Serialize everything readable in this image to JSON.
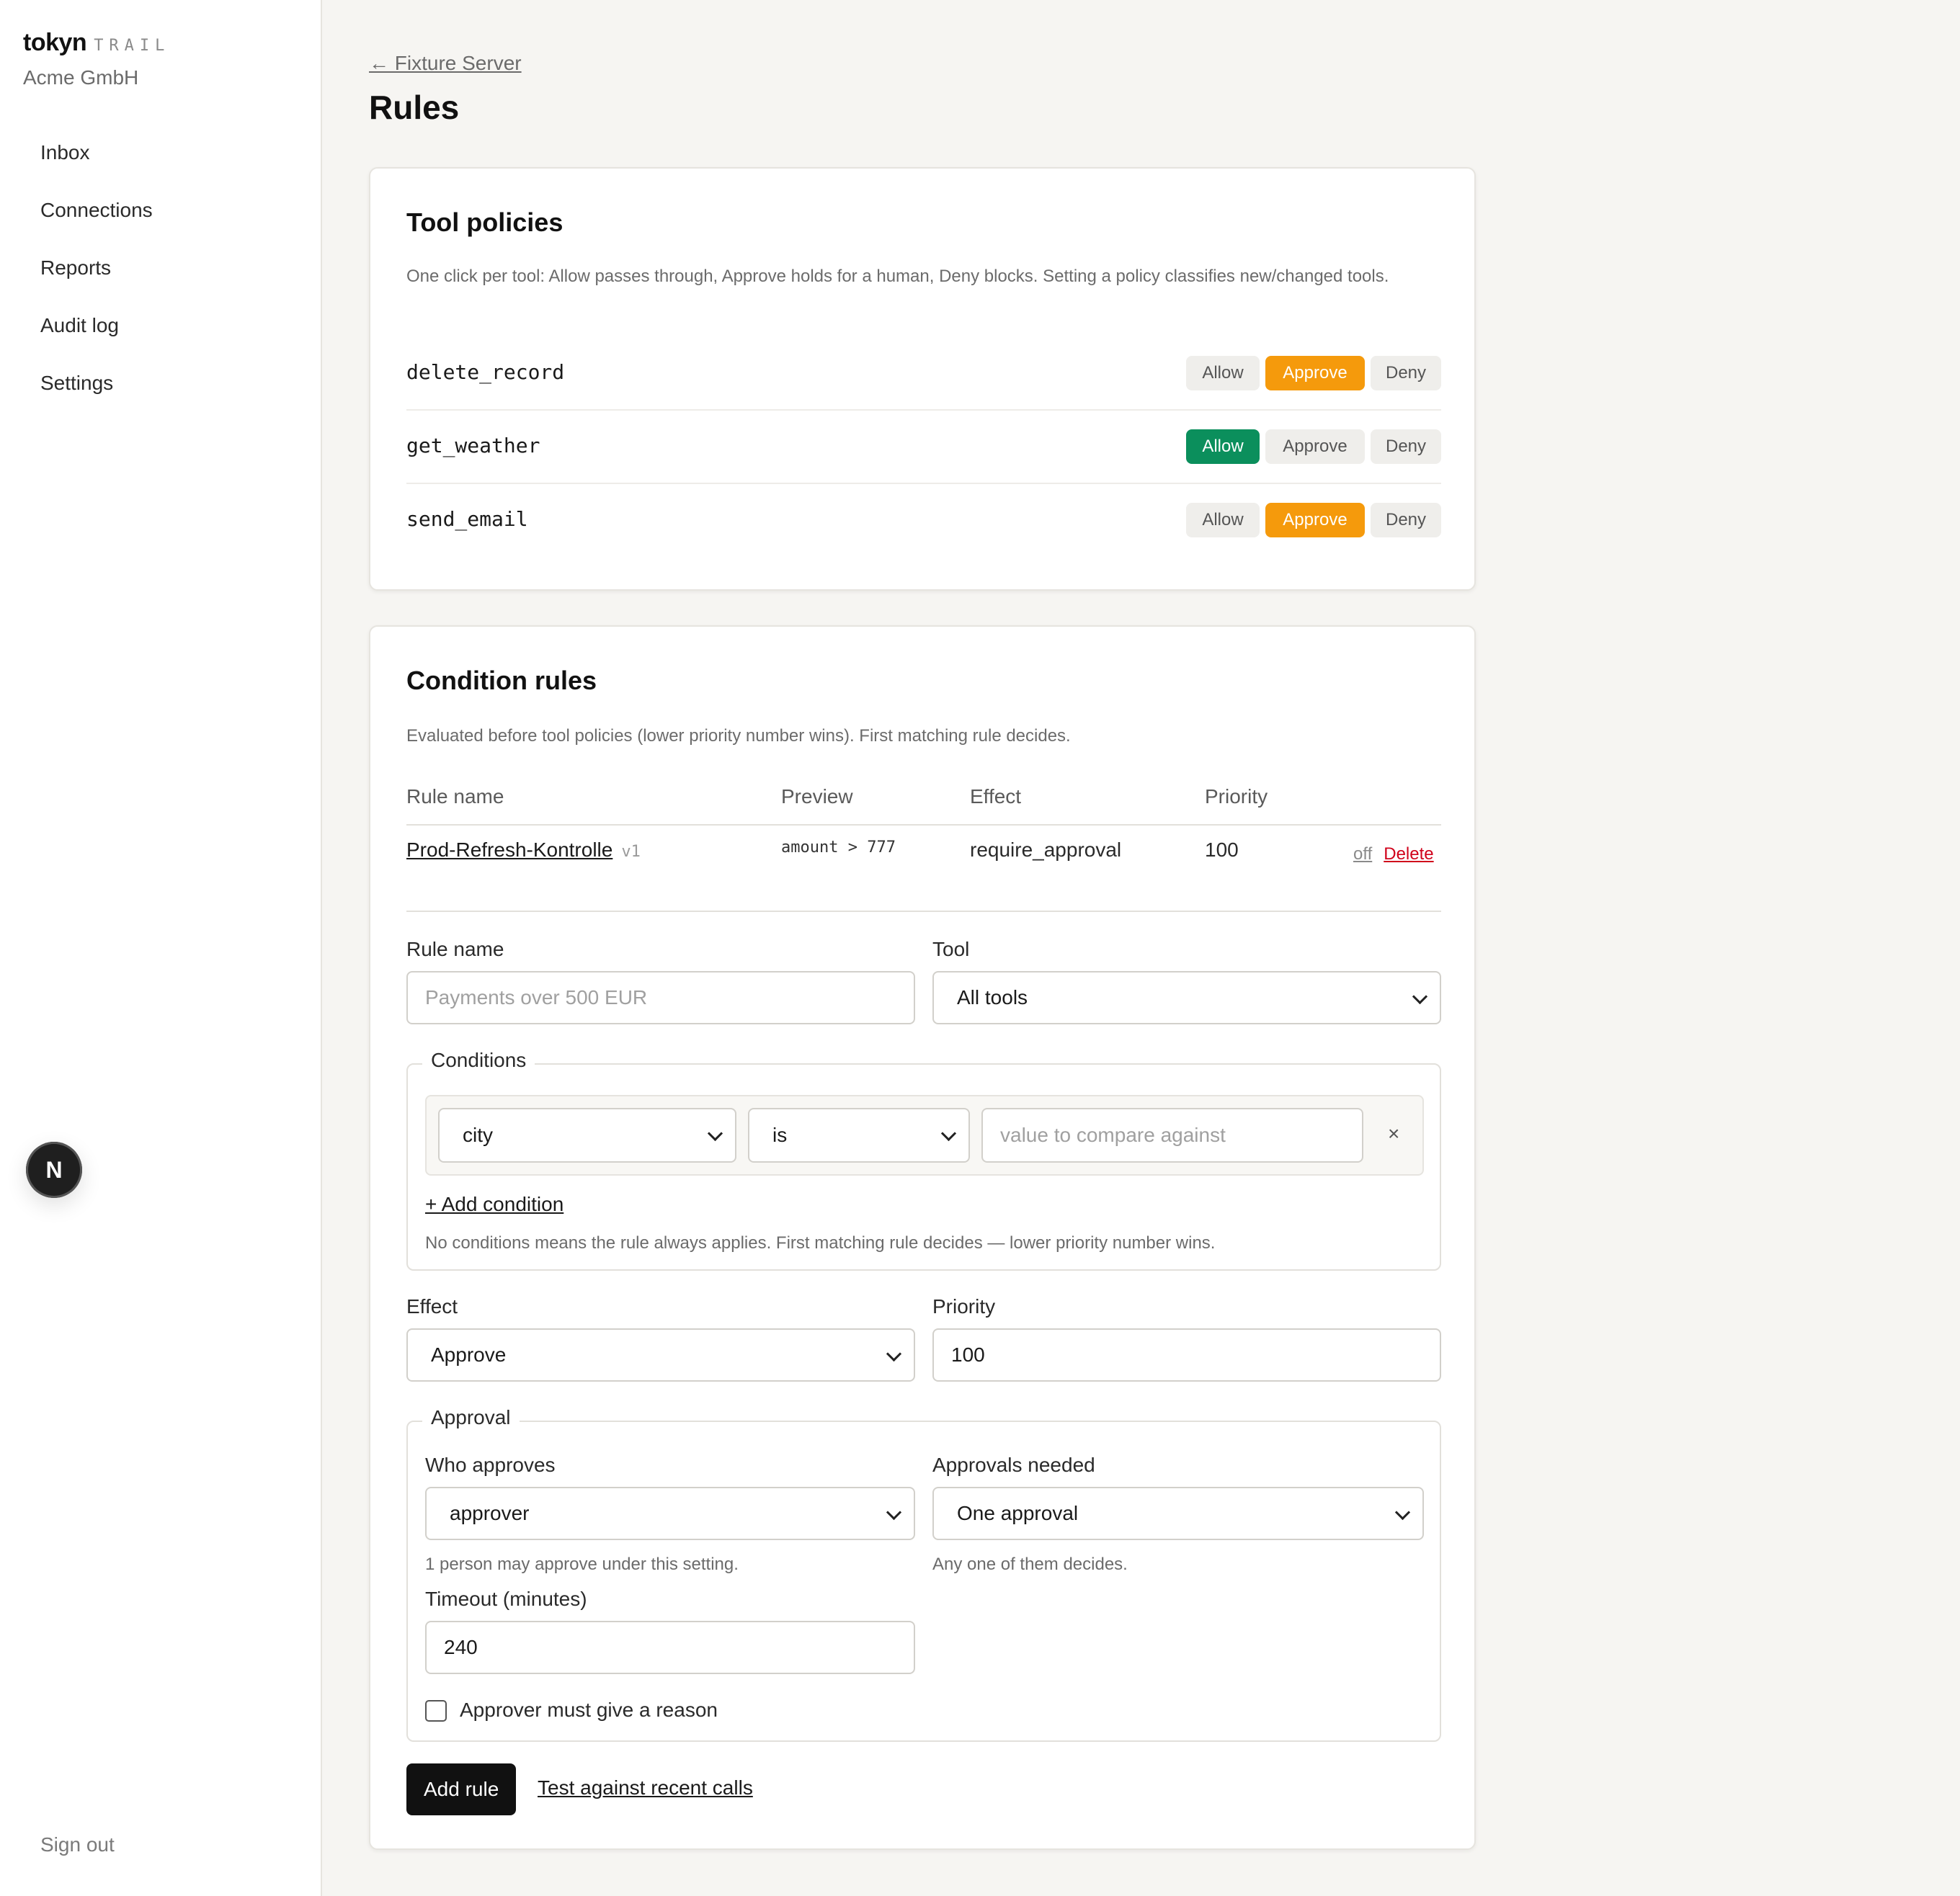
{
  "brand": {
    "name": "tokyn",
    "tag": "TRAIL",
    "org": "Acme GmbH"
  },
  "nav": {
    "items": [
      "Inbox",
      "Connections",
      "Reports",
      "Audit log",
      "Settings"
    ],
    "signout": "Sign out"
  },
  "floating_badge": {
    "letter": "N"
  },
  "header": {
    "back_link": "← Fixture Server",
    "title": "Rules"
  },
  "tool_policies": {
    "title": "Tool policies",
    "description": "One click per tool: Allow passes through, Approve holds for a human, Deny blocks. Setting a policy classifies new/changed tools.",
    "options": {
      "allow": "Allow",
      "approve": "Approve",
      "deny": "Deny"
    },
    "tools": [
      {
        "name": "delete_record",
        "selected": "Approve"
      },
      {
        "name": "get_weather",
        "selected": "Allow"
      },
      {
        "name": "send_email",
        "selected": "Approve"
      }
    ],
    "colors": {
      "approve_active": "#f59a0c",
      "allow_active": "#0b8f5c"
    }
  },
  "condition_rules": {
    "title": "Condition rules",
    "description": "Evaluated before tool policies (lower priority number wins). First matching rule decides.",
    "columns": [
      "Rule name",
      "Preview",
      "Effect",
      "Priority"
    ],
    "rows": [
      {
        "name": "Prod-Refresh-Kontrolle",
        "version": "v1",
        "preview": "amount > 777",
        "effect": "require_approval",
        "priority": "100",
        "toggle": "off",
        "delete": "Delete"
      }
    ]
  },
  "form": {
    "rule_name_label": "Rule name",
    "rule_name_placeholder": "Payments over 500 EUR",
    "tool_label": "Tool",
    "tool_value": "All tools",
    "conditions_legend": "Conditions",
    "condition": {
      "field": "city",
      "operator": "is",
      "value_placeholder": "value to compare against",
      "remove": "×"
    },
    "add_condition": "+ Add condition",
    "conditions_help": "No conditions means the rule always applies. First matching rule decides — lower priority number wins.",
    "effect_label": "Effect",
    "effect_value": "Approve",
    "priority_label": "Priority",
    "priority_value": "100",
    "approval_legend": "Approval",
    "who_label": "Who approves",
    "who_value": "approver",
    "who_help": "1 person may approve under this setting.",
    "needed_label": "Approvals needed",
    "needed_value": "One approval",
    "needed_help": "Any one of them decides.",
    "timeout_label": "Timeout (minutes)",
    "timeout_value": "240",
    "reason_checkbox": "Approver must give a reason",
    "reason_checked": false,
    "submit": "Add rule",
    "test_link": "Test against recent calls"
  }
}
